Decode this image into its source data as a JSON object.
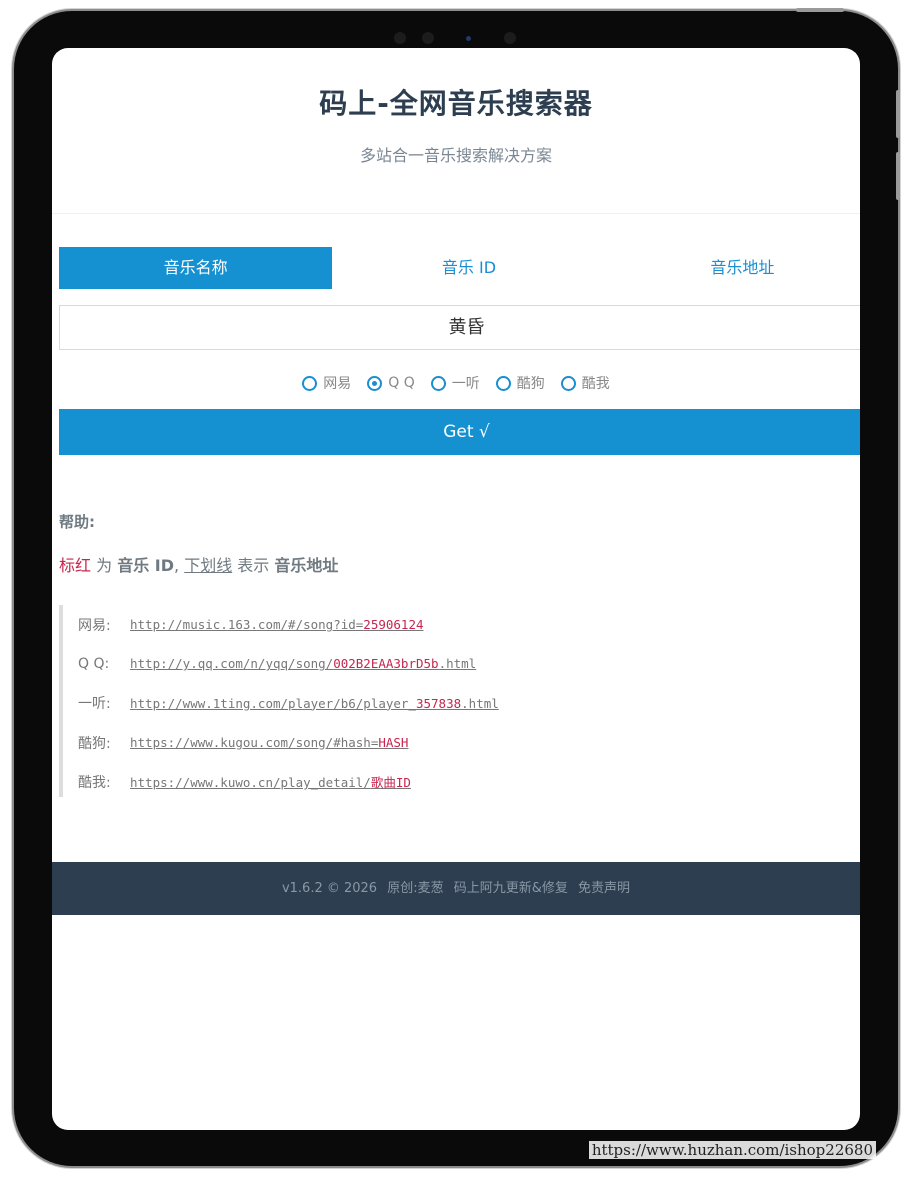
{
  "header": {
    "title": "码上-全网音乐搜索器",
    "subtitle": "多站合一音乐搜索解决方案"
  },
  "tabs": [
    {
      "label": "音乐名称",
      "active": true
    },
    {
      "label": "音乐 ID",
      "active": false
    },
    {
      "label": "音乐地址",
      "active": false
    }
  ],
  "search": {
    "value": "黄昏"
  },
  "sources": [
    {
      "label": "网易",
      "checked": false
    },
    {
      "label": "Q Q",
      "checked": true
    },
    {
      "label": "一听",
      "checked": false
    },
    {
      "label": "酷狗",
      "checked": false
    },
    {
      "label": "酷我",
      "checked": false
    }
  ],
  "get_button": {
    "label": "Get √"
  },
  "help": {
    "title": "帮助:",
    "red_label": "标红",
    "word_is": " 为 ",
    "music_id": "音乐 ID",
    "sep": ", ",
    "underline_label": "下划线",
    "word_means": " 表示 ",
    "music_url": "音乐地址"
  },
  "examples": [
    {
      "label": "网易:",
      "url_prefix": "http://music.163.com/#/song?id=",
      "url_id": "25906124",
      "url_suffix": ""
    },
    {
      "label": "Q Q:",
      "url_prefix": "http://y.qq.com/n/yqq/song/",
      "url_id": "002B2EAA3brD5b",
      "url_suffix": ".html"
    },
    {
      "label": "一听:",
      "url_prefix": "http://www.1ting.com/player/b6/player_",
      "url_id": "357838",
      "url_suffix": ".html"
    },
    {
      "label": "酷狗:",
      "url_prefix": "https://www.kugou.com/song/#hash=",
      "url_id": "HASH",
      "url_suffix": ""
    },
    {
      "label": "酷我:",
      "url_prefix": "https://www.kuwo.cn/play_detail/",
      "url_id": "歌曲ID",
      "url_suffix": ""
    }
  ],
  "footer": {
    "version": "v1.6.2 © 2026",
    "original": "原创:麦葱",
    "update": "码上阿九更新&修复",
    "disclaimer": "免责声明"
  },
  "watermark": "https://www.huzhan.com/ishop22680",
  "colors": {
    "accent": "#1591d2",
    "highlight": "#c7254e",
    "footer_bg": "#2c3e50"
  }
}
